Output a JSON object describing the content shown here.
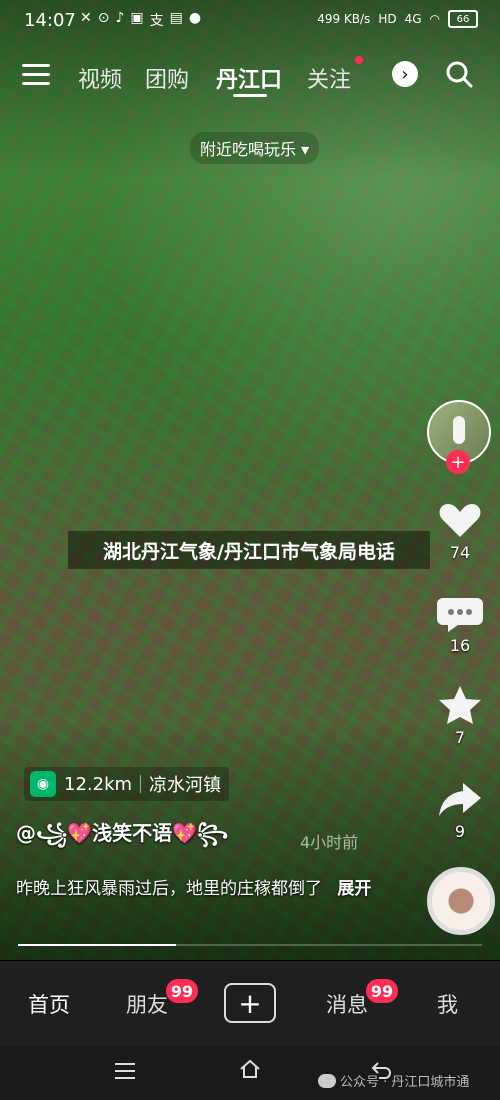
{
  "status": {
    "time": "14:07",
    "left_icons": [
      "✕",
      "⊙",
      "♪",
      "▣",
      "支",
      "▤",
      "●"
    ],
    "network_speed": "499 KB/s",
    "hd": "HD",
    "network": "4G",
    "battery": "66"
  },
  "nav": {
    "tabs": [
      "视频",
      "团购",
      "丹江口",
      "关注"
    ],
    "active_tab": "丹江口",
    "nearby_label": "附近吃喝玩乐 ▾"
  },
  "video": {
    "overlay_title": "湖北丹江气象/丹江口市气象局电话",
    "likes": "74",
    "comments": "16",
    "favorites": "7",
    "shares": "9",
    "location_distance": "12.2km",
    "location_name": "凉水河镇",
    "author": "@꧁💖浅笑不语💖꧂",
    "time_ago": "4小时前",
    "caption": "昨晚上狂风暴雨过后，地里的庄稼都倒了",
    "expand": "展开",
    "progress": 0.34
  },
  "bottom_nav": {
    "home": "首页",
    "friends": "朋友",
    "friends_badge": "99",
    "create": "+",
    "messages": "消息",
    "messages_badge": "99",
    "me": "我"
  },
  "system": {
    "watermark": "公众号 · 丹江口城市通"
  },
  "colors": {
    "accent": "#ff2d55",
    "location": "#00b66f"
  }
}
